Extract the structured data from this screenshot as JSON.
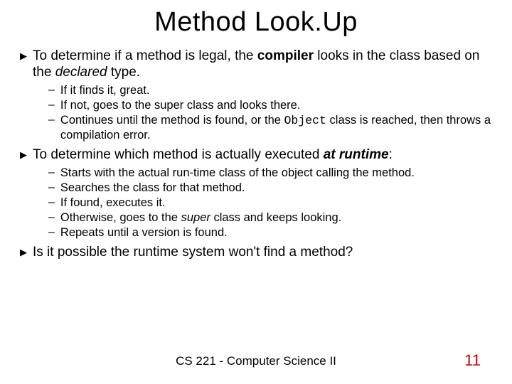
{
  "title": "Method Look.Up",
  "b1": {
    "pre": "To determine if a method is legal, the ",
    "compiler": "compiler",
    "mid": " looks in the class based on the ",
    "declared": "declared",
    "post": " type."
  },
  "s1a": "If it finds it, great.",
  "s1b": "If not, goes to the super class and looks there.",
  "s1c_pre": "Continues until the method is found, or the ",
  "s1c_obj": "Object",
  "s1c_post": " class is reached, then throws a compilation error.",
  "b2": {
    "pre": "To determine which method is actually executed ",
    "runtime": "at runtime",
    "post": ":"
  },
  "s2a": "Starts with the actual run-time class of the object calling the method.",
  "s2b": "Searches the class for that method.",
  "s2c": "If found, executes it.",
  "s2d_pre": "Otherwise, goes to the ",
  "s2d_super": "super",
  "s2d_post": " class and keeps looking.",
  "s2e": "Repeats until a version is found.",
  "b3": "Is it possible the runtime system won't find a method?",
  "footer": "CS 221 - Computer Science II",
  "page": "11",
  "dash": "–",
  "arrow": "▶"
}
